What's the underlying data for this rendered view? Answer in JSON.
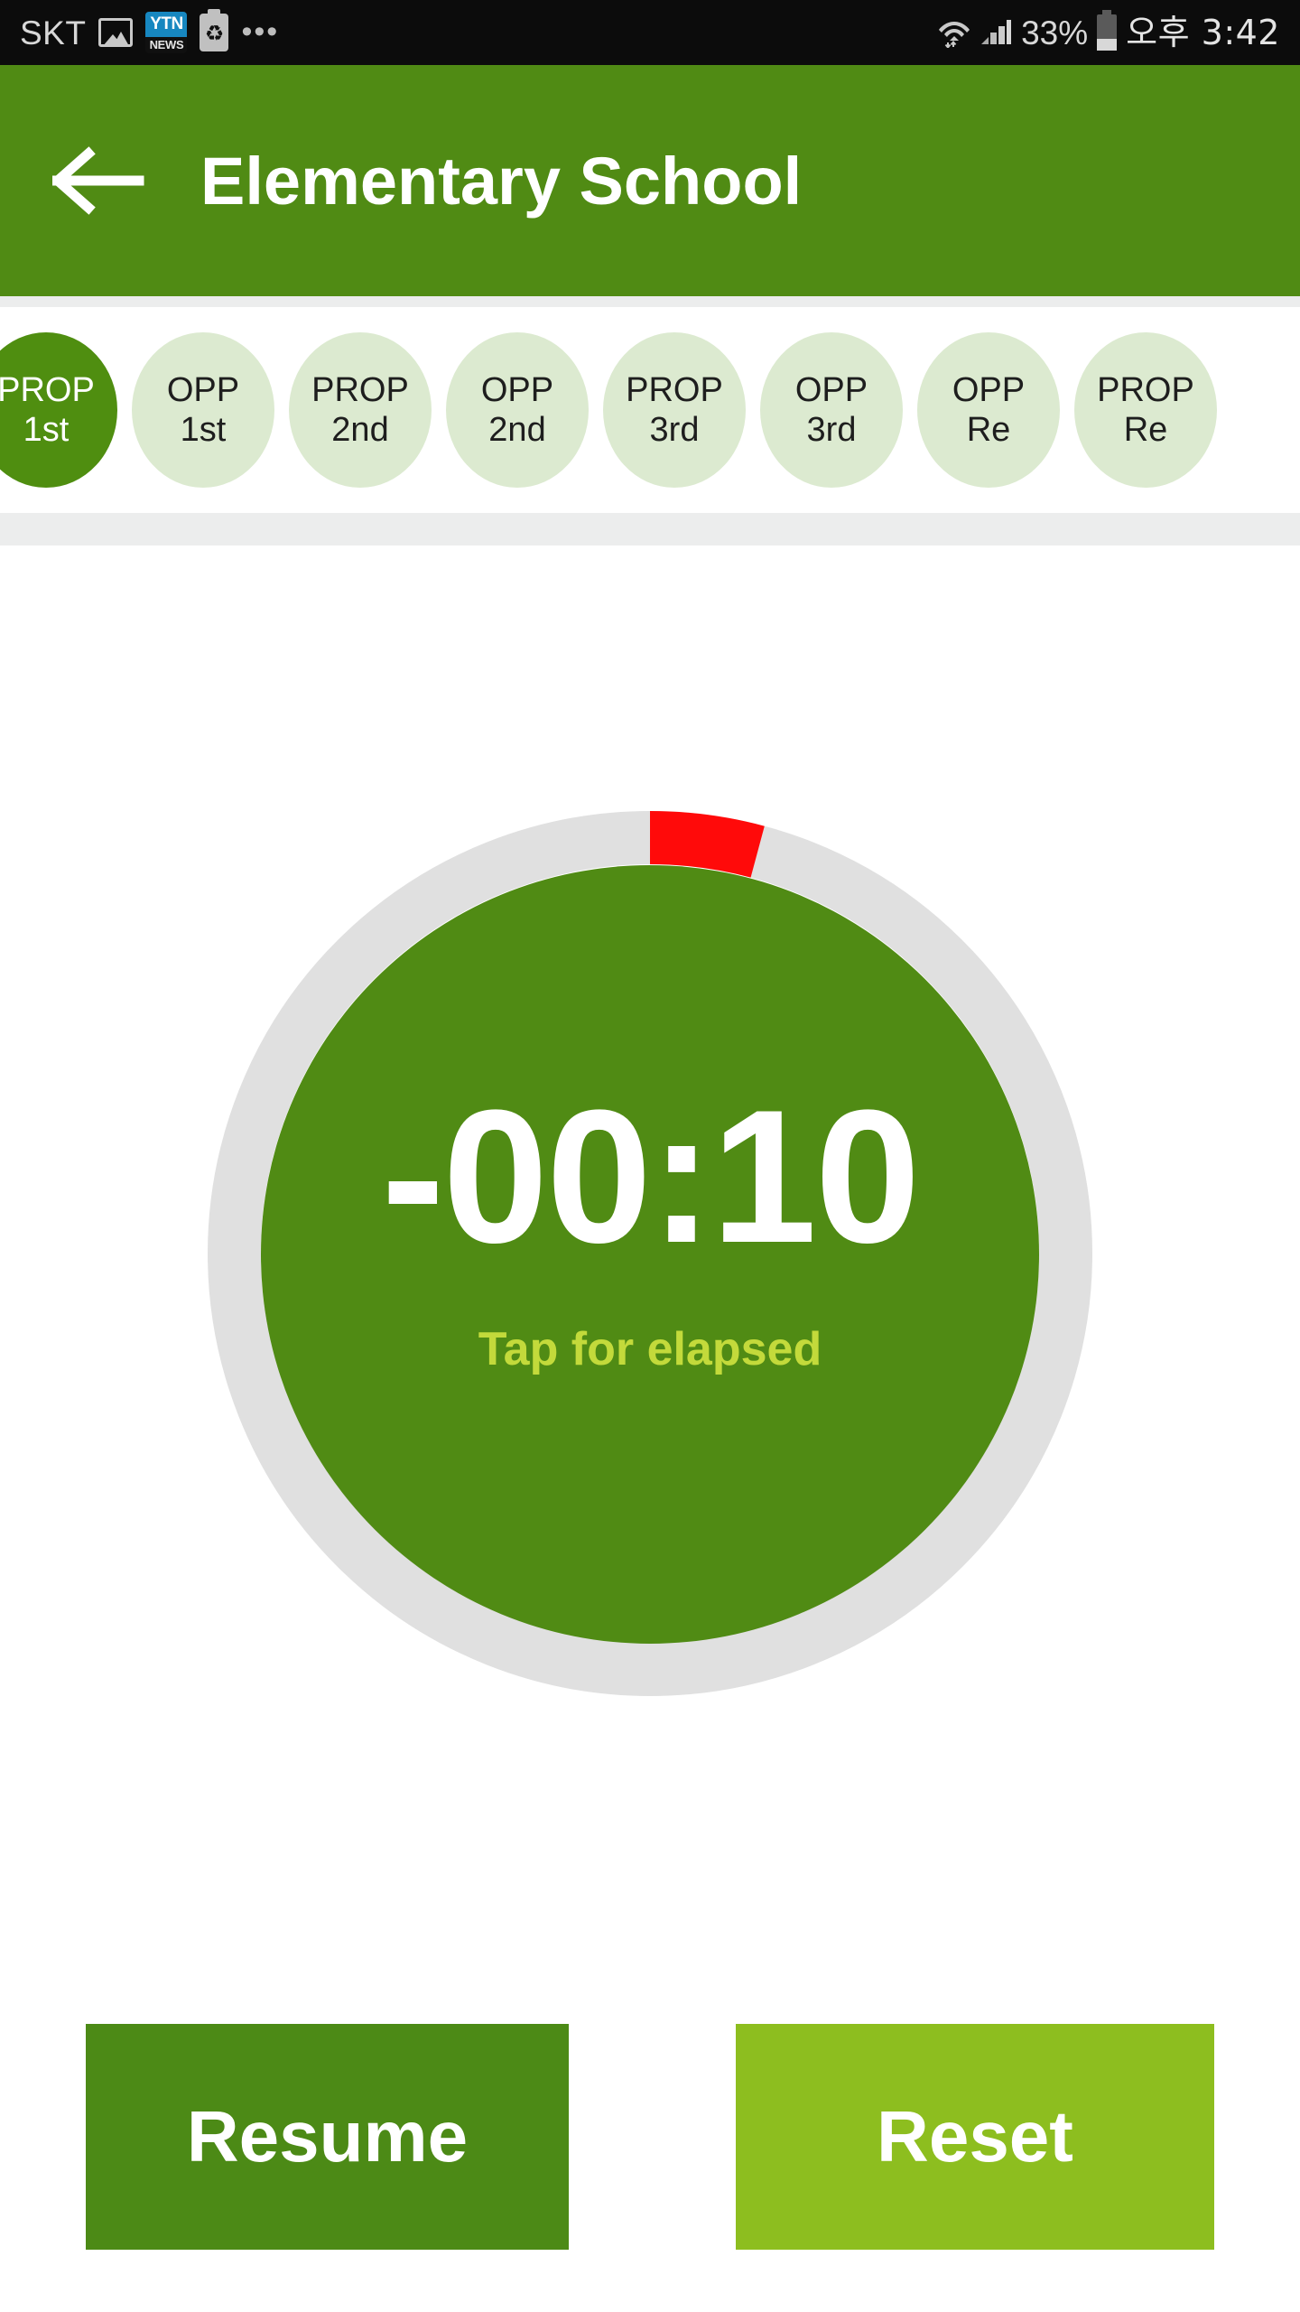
{
  "status_bar": {
    "carrier": "SKT",
    "icons": [
      "photo-icon",
      "ytn-news-icon",
      "recycle-icon",
      "more-dots-icon",
      "wifi-icon",
      "cellular-signal-icon",
      "battery-icon"
    ],
    "ytn_top": "YTN",
    "ytn_bottom": "NEWS",
    "recycle_glyph": "♻",
    "more_dots": "•••",
    "battery_percent": "33%",
    "clock": "오후 3:42"
  },
  "header": {
    "back_icon": "back-arrow-icon",
    "title": "Elementary School",
    "background_color": "#508B14"
  },
  "speaker_chips": {
    "items": [
      {
        "side": "PROP",
        "order": "1st",
        "active": true
      },
      {
        "side": "OPP",
        "order": "1st",
        "active": false
      },
      {
        "side": "PROP",
        "order": "2nd",
        "active": false
      },
      {
        "side": "OPP",
        "order": "2nd",
        "active": false
      },
      {
        "side": "PROP",
        "order": "3rd",
        "active": false
      },
      {
        "side": "OPP",
        "order": "3rd",
        "active": false
      },
      {
        "side": "OPP",
        "order": "Re",
        "active": false
      },
      {
        "side": "PROP",
        "order": "Re",
        "active": false
      }
    ],
    "active_color": "#4F8E10",
    "inactive_color": "#DCEAD0"
  },
  "timer": {
    "value": "-00:10",
    "hint": "Tap for elapsed",
    "hint_color": "#C3DA3B",
    "dial": {
      "track_color": "#E0E0E0",
      "overtime_color": "#FF0A0A",
      "face_color": "#508B14",
      "overtime_start_deg": 0,
      "overtime_sweep_deg": 15,
      "overtime_fraction": 0.042
    }
  },
  "actions": {
    "resume_label": "Resume",
    "resume_color": "#4C8A16",
    "reset_label": "Reset",
    "reset_color": "#8DBE1F"
  }
}
